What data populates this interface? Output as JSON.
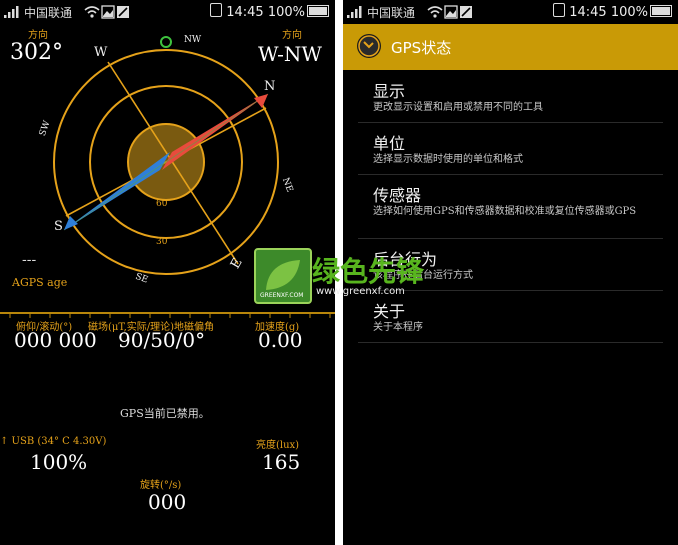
{
  "status_bar": {
    "carrier": "中国联通",
    "time": "14:45",
    "battery": "100%"
  },
  "left": {
    "heading_label": "方向",
    "heading_degrees": "302°",
    "direction_label": "方向",
    "direction": "W-NW",
    "compass_labels": {
      "north": "N",
      "nw": "NW",
      "west": "W",
      "sw": "SW",
      "south": "S",
      "se": "SE",
      "east": "E",
      "ne": "NE",
      "ring_60": "60",
      "ring_30": "30"
    },
    "agps_value": "---",
    "agps_label": "AGPS age",
    "pitch_roll_label": "俯仰/滚动(°)",
    "pitch_roll_value": "000 000",
    "magnetic_label": "磁场(μT,实际/理论)地磁偏角",
    "magnetic_value": "90/50/0°",
    "accel_label": "加速度(g)",
    "accel_value": "0.00",
    "gps_message": "GPS当前已禁用。",
    "battery_label": "↑ USB (34° C 4.30V)",
    "battery_value": "100%",
    "brightness_label": "亮度(lux)",
    "brightness_value": "165",
    "rotation_label": "旋转(°/s)",
    "rotation_value": "000"
  },
  "right": {
    "app_title": "GPS状态",
    "menu": [
      {
        "title": "显示",
        "subtitle": "更改显示设置和启用或禁用不同的工具"
      },
      {
        "title": "单位",
        "subtitle": "选择显示数据时使用的单位和格式"
      },
      {
        "title": "传感器",
        "subtitle": "选择如何使用GPS和传感器数据和校准或复位传感器或GPS"
      },
      {
        "title": "后台行为",
        "subtitle": "该程序在后台运行方式"
      },
      {
        "title": "关于",
        "subtitle": "关于本程序"
      }
    ]
  },
  "watermark": {
    "logo_text": "GREENXF.COM",
    "brand": "绿色先锋",
    "url": "www.greenxf.com"
  },
  "colors": {
    "accent": "#e5a21a",
    "appbar": "#c99a06",
    "needle_red": "#e84b3c",
    "needle_blue": "#2f7fd8",
    "background": "#000000"
  }
}
